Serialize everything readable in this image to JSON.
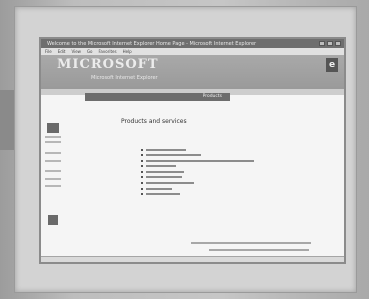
{
  "window": {
    "title": "Welcome to the Microsoft Internet Explorer Home Page - Microsoft Internet Explorer",
    "buttons": [
      "minimize",
      "maximize",
      "close"
    ]
  },
  "menu": [
    "File",
    "Edit",
    "View",
    "Go",
    "Favorites",
    "Help"
  ],
  "banner": {
    "title": "MICROSOFT",
    "subtitle": "Microsoft Internet Explorer",
    "logo_icon": "ie-logo"
  },
  "section_bar": {
    "label": "Products"
  },
  "content": {
    "heading": "Products and services",
    "links": [
      {
        "label": "Internet Explorer"
      },
      {
        "label": "Internet Mail and News"
      },
      {
        "label": "Microsoft Office, Visual Studio and more"
      },
      {
        "label": "Windows"
      },
      {
        "label": "Windows NT"
      },
      {
        "label": "BackOffice"
      },
      {
        "label": "Developer Tools"
      },
      {
        "label": "Games"
      },
      {
        "label": "Multimedia"
      }
    ]
  },
  "colors": {
    "banner": "#9a9a9a",
    "section_bar": "#6d6d6d",
    "page_bg": "#f5f5f5"
  }
}
